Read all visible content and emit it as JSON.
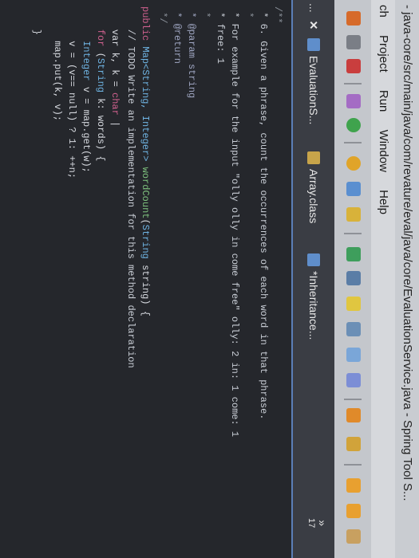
{
  "window": {
    "title": "- java-core/src/main/java/com/revature/eval/java/core/EvaluationService.java - Spring Tool S..."
  },
  "menu": {
    "items": [
      "ch",
      "Project",
      "Run",
      "Window",
      "Help"
    ]
  },
  "tabs": {
    "overflow_label": "...",
    "items": [
      {
        "label": "EvaluationS...",
        "icon": "java-file-icon"
      },
      {
        "label": "Array.class",
        "icon": "class-file-icon"
      },
      {
        "label": "*Inheritance...",
        "icon": "java-file-icon"
      }
    ],
    "more_count": "17",
    "more_chevron": "»"
  },
  "editor": {
    "lines": {
      "l1": "/**",
      "l2": " * 6. Given a phrase, count the occurrences of each word in that phrase.",
      "l3": " *",
      "l4": " * For example for the input \"olly olly in come free\" olly: 2 in: 1 come: 1",
      "l5": " * free: 1",
      "l6": " *",
      "l7": " * @param string",
      "l8": " * @return",
      "l9": " */",
      "l10_kw": "public",
      "l10_type": "Map<String, Integer>",
      "l10_fn": "wordCount",
      "l10_param_type": "String",
      "l10_rest": "string) {",
      "l11": "    // TODO Write an implementation for this method declaration",
      "l12_a": "    var k, k = ",
      "l12_b": "char",
      "l13_kw": "    for",
      "l13_a": " (",
      "l13_type": "String",
      "l13_b": " k: words) {",
      "l14_type": "      Integer",
      "l14_rest": " v = map.get(w);",
      "l15": "      v = (v== null) ? 1: ++n;",
      "l16": "      map.put(k, v);",
      "l17": "    }"
    }
  },
  "colors": {
    "accent": "#5b7fb8",
    "keyword": "#d1618f",
    "type": "#6fb4e3",
    "comment": "#8a9099"
  }
}
